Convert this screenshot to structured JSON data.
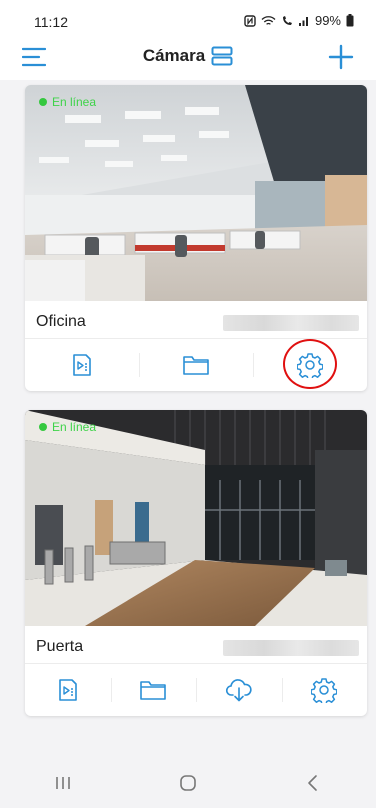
{
  "status": {
    "time": "11:12",
    "battery": "99%"
  },
  "header": {
    "title": "Cámara"
  },
  "colors": {
    "accent": "#2a8fd6",
    "online": "#35c83f",
    "highlight": "#e01010"
  },
  "cameras": [
    {
      "name": "Oficina",
      "status": "En línea",
      "actions": [
        "playback-icon",
        "folder-icon",
        "settings-icon"
      ]
    },
    {
      "name": "Puerta",
      "status": "En línea",
      "actions": [
        "playback-icon",
        "folder-icon",
        "cloud-download-icon",
        "settings-icon"
      ]
    }
  ],
  "navigation": [
    "recents-icon",
    "home-icon",
    "back-icon"
  ]
}
